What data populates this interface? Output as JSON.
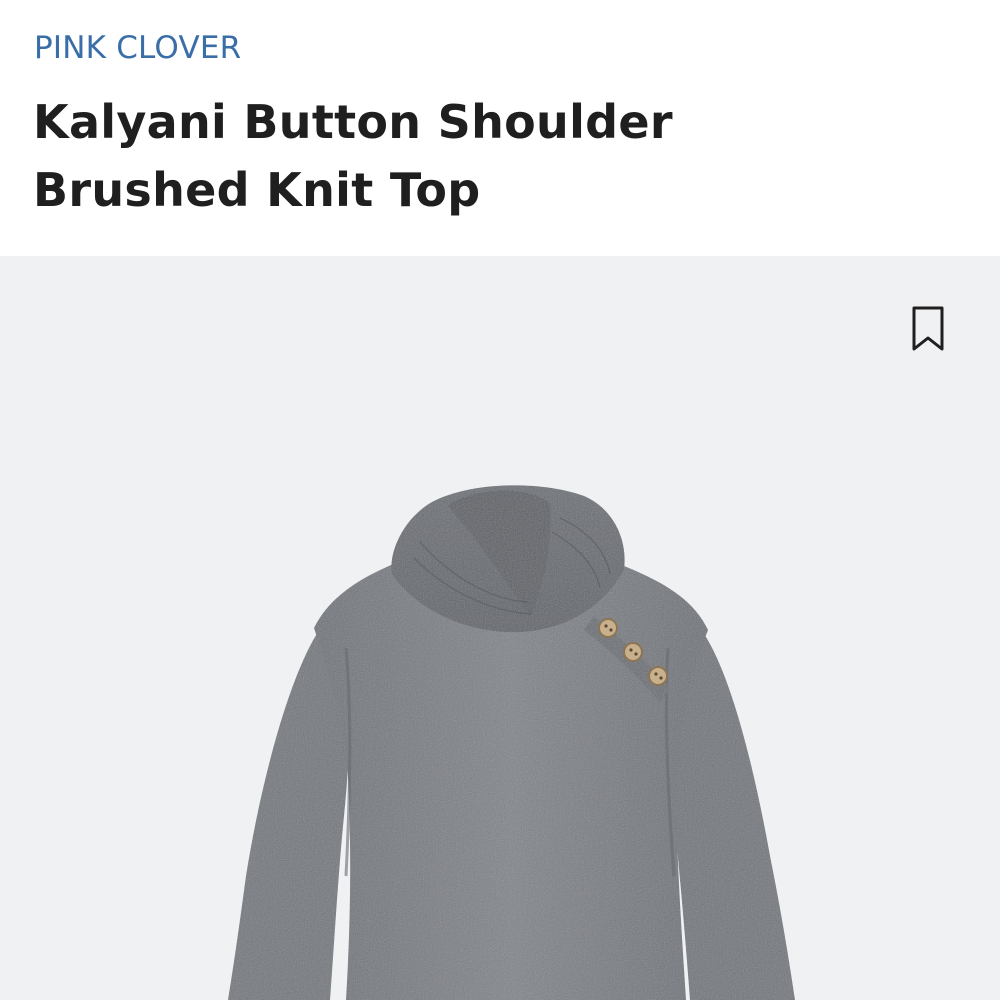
{
  "product": {
    "brand": "PINK CLOVER",
    "title": "Kalyani Button Shoulder Brushed Knit Top"
  },
  "icons": {
    "bookmark": "bookmark-icon"
  },
  "colors": {
    "brand": "#3a6ea8",
    "title": "#1f1f1f",
    "image_background": "#f0f1f3",
    "garment": "#7a7e84"
  }
}
